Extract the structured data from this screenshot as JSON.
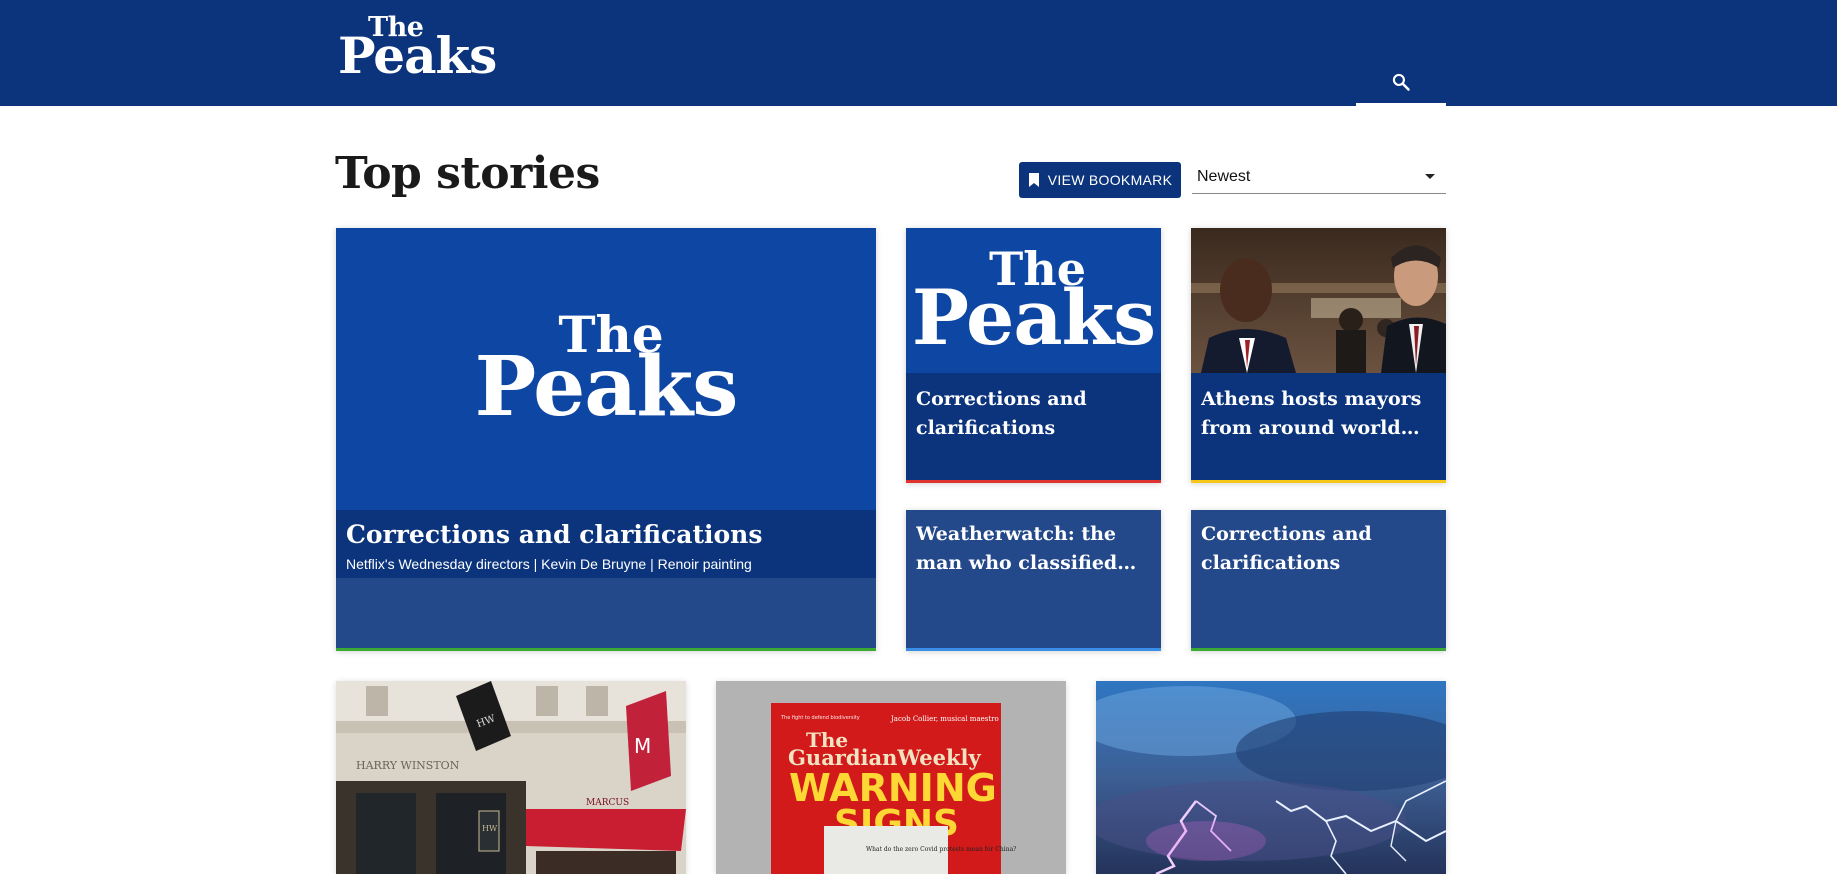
{
  "header": {
    "logo_the": "The",
    "logo_peaks": "Peaks",
    "search_icon": "search-icon"
  },
  "page": {
    "title": "Top stories",
    "bookmark_label": "VIEW BOOKMARK",
    "bookmark_icon": "bookmark-icon",
    "sort_value": "Newest",
    "sort_icon": "caret-down-icon"
  },
  "cards": [
    {
      "title": "Corrections and clarifications",
      "subtitle": "Netflix's Wednesday directors | Kevin De Bruyne | Renoir painting",
      "image_logo_the": "The",
      "image_logo_peaks": "Peaks",
      "accent": "#3aaa35"
    },
    {
      "title": "Corrections and clarifications",
      "image_logo_the": "The",
      "image_logo_peaks": "Peaks",
      "accent": "#e03131"
    },
    {
      "title": "Athens hosts mayors from around world for...",
      "image": "photo-two-men-talking",
      "accent": "#f5c518"
    },
    {
      "title": "Weatherwatch: the man who classified the clouds",
      "accent": "#3b8ee8"
    },
    {
      "title": "Corrections and clarifications",
      "accent": "#3aaa35"
    }
  ],
  "bottom_cards": [
    {
      "image": "photo-harry-winston-storefront"
    },
    {
      "image": "photo-guardian-weekly-cover",
      "cover_top_left": "The fight to defend biodiversity",
      "cover_top_right": "Jacob Collier, musical maestro",
      "cover_brand_the": "The",
      "cover_brand": "GuardianWeekly",
      "cover_headline_1": "WARNING",
      "cover_headline_2": "SIGNS",
      "cover_question": "What do the zero Covid protests mean for China?"
    },
    {
      "image": "photo-lightning-storm"
    }
  ],
  "storefront": {
    "sign": "HARRY WINSTON",
    "banner_letters": "HW",
    "awning": "MARCUS"
  },
  "colors": {
    "header_bg": "#0b347c",
    "brand_blue": "#0e46a3",
    "caption_bg": "#0b347c",
    "card_bg": "#24498a"
  }
}
